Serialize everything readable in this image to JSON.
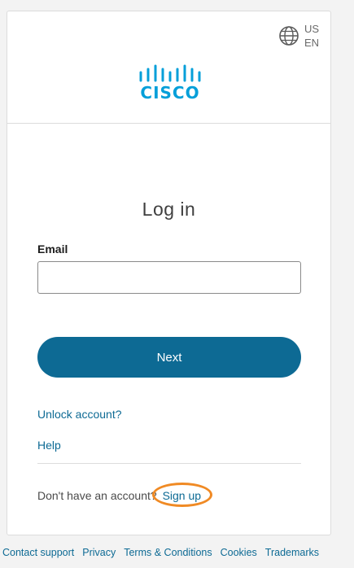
{
  "header": {
    "locale_line1": "US",
    "locale_line2": "EN",
    "logo_text": "CISCO",
    "brand_color": "#049fd9"
  },
  "form": {
    "title": "Log in",
    "email_label": "Email",
    "email_value": "",
    "next_label": "Next"
  },
  "links": {
    "unlock": "Unlock account?",
    "help": "Help",
    "no_account": "Don't have an account?",
    "signup": "Sign up"
  },
  "footer": {
    "items": [
      "Contact support",
      "Privacy",
      "Terms & Conditions",
      "Cookies",
      "Trademarks"
    ]
  },
  "colors": {
    "accent": "#0d6a94",
    "highlight": "#f08a24"
  }
}
